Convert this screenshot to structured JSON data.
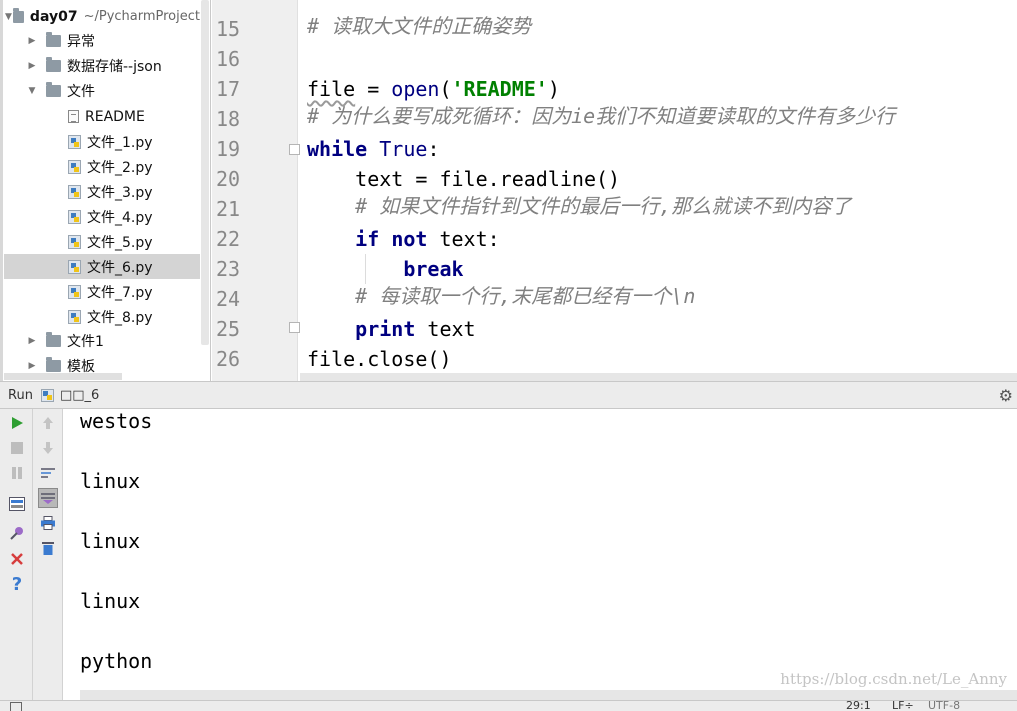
{
  "project": {
    "root": {
      "name": "day07",
      "path": "~/PycharmProject"
    },
    "items": [
      {
        "label": "异常"
      },
      {
        "label": "数据存储--json"
      },
      {
        "label": "文件"
      },
      {
        "label": "README"
      },
      {
        "label": "文件_1.py"
      },
      {
        "label": "文件_2.py"
      },
      {
        "label": "文件_3.py"
      },
      {
        "label": "文件_4.py"
      },
      {
        "label": "文件_5.py"
      },
      {
        "label": "文件_6.py"
      },
      {
        "label": "文件_7.py"
      },
      {
        "label": "文件_8.py"
      },
      {
        "label": "文件1"
      },
      {
        "label": "模板"
      }
    ],
    "selected": "文件_6.py"
  },
  "editor": {
    "line_numbers": [
      "15",
      "16",
      "17",
      "18",
      "19",
      "20",
      "21",
      "22",
      "23",
      "24",
      "25",
      "26"
    ],
    "code": {
      "l15": "# 读取大文件的正确姿势",
      "l17_var": "file",
      "l17_eq": " = ",
      "l17_func": "open",
      "l17_open": "(",
      "l17_str": "'README'",
      "l17_close": ")",
      "l18": "# 为什么要写成死循环：因为ie我们不知道要读取的文件有多少行",
      "l19_kw": "while",
      "l19_true": "True",
      "l19_colon": ":",
      "l20": "    text = file.readline()",
      "l21": "    # 如果文件指针到文件的最后一行,那么就读不到内容了",
      "l22_pre": "    ",
      "l22_if": "if",
      "l22_not": "not",
      "l22_rest": " text:",
      "l23_pre": "        ",
      "l23_kw": "break",
      "l24": "    # 每读取一个行,末尾都已经有一个\\n",
      "l25_pre": "    ",
      "l25_kw": "print",
      "l25_rest": " text",
      "l26": "file.close()"
    }
  },
  "run": {
    "label": "Run",
    "tab": "□□_6",
    "output": [
      "westos",
      "linux",
      "linux",
      "linux",
      "python"
    ]
  },
  "status": {
    "position": "29:1",
    "line_sep": "LF÷",
    "encoding": "UTF-8"
  },
  "watermark": "https://blog.csdn.net/Le_Anny",
  "colors": {
    "keyword": "#000080",
    "string": "#008000",
    "comment": "#808080",
    "run_green": "#2e9e32",
    "close_red": "#d63c3c",
    "help_blue": "#3b7bd0"
  },
  "icons": {
    "run": "play-icon",
    "stop": "stop-icon",
    "pause": "pause-icon",
    "settings": "gear-icon"
  }
}
